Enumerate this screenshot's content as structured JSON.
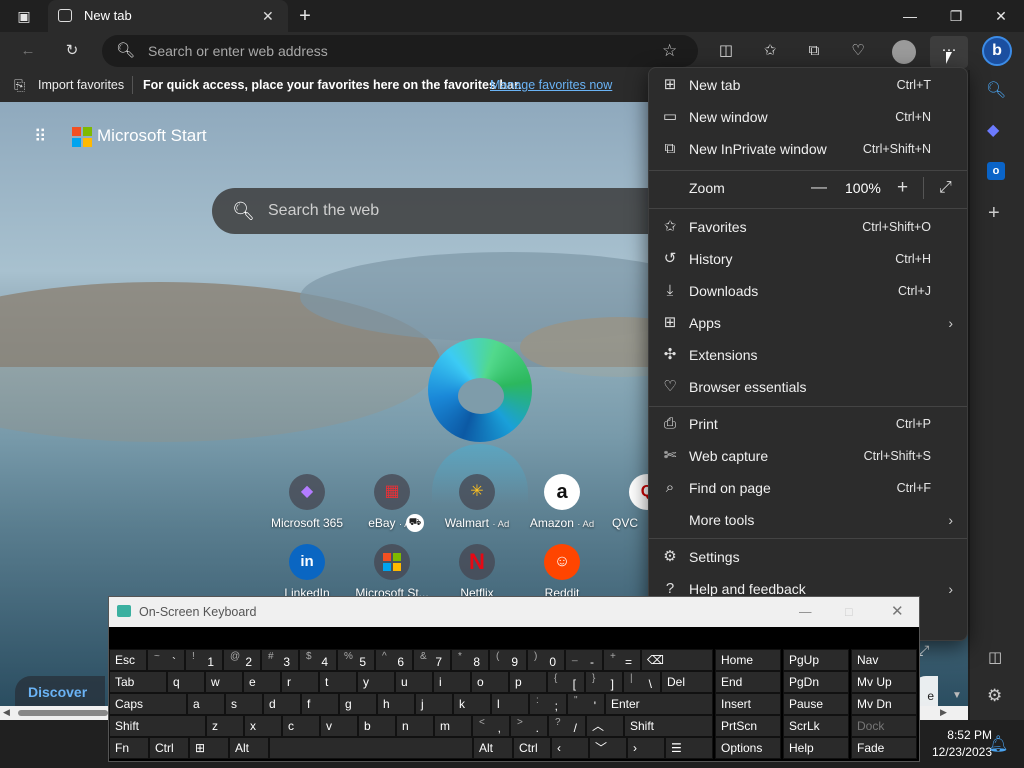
{
  "tab": {
    "title": "New tab"
  },
  "address": {
    "placeholder": "Search or enter web address"
  },
  "favorites_bar": {
    "import_label": "Import favorites",
    "hint": "For quick access, place your favorites here on the favorites bar.",
    "manage_link": "Manage favorites now"
  },
  "page": {
    "brand": "Microsoft Start",
    "search_placeholder": "Search the web",
    "discover": "Discover",
    "tiles": [
      {
        "label": "Microsoft 365",
        "ad": ""
      },
      {
        "label": "eBay",
        "ad": "· Ad"
      },
      {
        "label": "Walmart",
        "ad": "· Ad"
      },
      {
        "label": "Amazon",
        "ad": "· Ad"
      },
      {
        "label": "QVC",
        "ad": ""
      },
      {
        "label": "LinkedIn",
        "ad": ""
      },
      {
        "label": "Microsoft St...",
        "ad": ""
      },
      {
        "label": "Netflix",
        "ad": ""
      },
      {
        "label": "Reddit",
        "ad": ""
      }
    ]
  },
  "menu": {
    "items": [
      {
        "label": "New tab",
        "shortcut": "Ctrl+T"
      },
      {
        "label": "New window",
        "shortcut": "Ctrl+N"
      },
      {
        "label": "New InPrivate window",
        "shortcut": "Ctrl+Shift+N"
      },
      {
        "label": "Favorites",
        "shortcut": "Ctrl+Shift+O"
      },
      {
        "label": "History",
        "shortcut": "Ctrl+H"
      },
      {
        "label": "Downloads",
        "shortcut": "Ctrl+J"
      },
      {
        "label": "Apps",
        "shortcut": ""
      },
      {
        "label": "Extensions",
        "shortcut": ""
      },
      {
        "label": "Browser essentials",
        "shortcut": ""
      },
      {
        "label": "Print",
        "shortcut": "Ctrl+P"
      },
      {
        "label": "Web capture",
        "shortcut": "Ctrl+Shift+S"
      },
      {
        "label": "Find on page",
        "shortcut": "Ctrl+F"
      },
      {
        "label": "More tools",
        "shortcut": ""
      },
      {
        "label": "Settings",
        "shortcut": ""
      },
      {
        "label": "Help and feedback",
        "shortcut": ""
      }
    ],
    "zoom": {
      "label": "Zoom",
      "value": "100%"
    }
  },
  "osk": {
    "title": "On-Screen Keyboard",
    "row1": [
      "Esc",
      "~ `",
      "! 1",
      "@ 2",
      "# 3",
      "$ 4",
      "% 5",
      "^ 6",
      "& 7",
      "* 8",
      "( 9",
      ") 0",
      "_ -",
      "+ ="
    ],
    "row2": [
      "Tab",
      "q",
      "w",
      "e",
      "r",
      "t",
      "y",
      "u",
      "i",
      "o",
      "p",
      "{ [",
      "} ]",
      "| \\",
      "Del"
    ],
    "row3": [
      "Caps",
      "a",
      "s",
      "d",
      "f",
      "g",
      "h",
      "j",
      "k",
      "l",
      ": ;",
      "\" '",
      "Enter"
    ],
    "row4": [
      "Shift",
      "z",
      "x",
      "c",
      "v",
      "b",
      "n",
      "m",
      "< ,",
      "> .",
      "? /",
      "Shift"
    ],
    "row5": [
      "Fn",
      "Ctrl",
      "Alt",
      "Alt",
      "Ctrl"
    ],
    "nav": [
      [
        "Home",
        "PgUp",
        "Nav"
      ],
      [
        "End",
        "PgDn",
        "Mv Up"
      ],
      [
        "Insert",
        "Pause",
        "Mv Dn"
      ],
      [
        "PrtScn",
        "ScrLk",
        "Dock"
      ],
      [
        "Options",
        "Help",
        "Fade"
      ]
    ]
  },
  "taskbar": {
    "time": "8:52 PM",
    "date": "12/23/2023"
  }
}
